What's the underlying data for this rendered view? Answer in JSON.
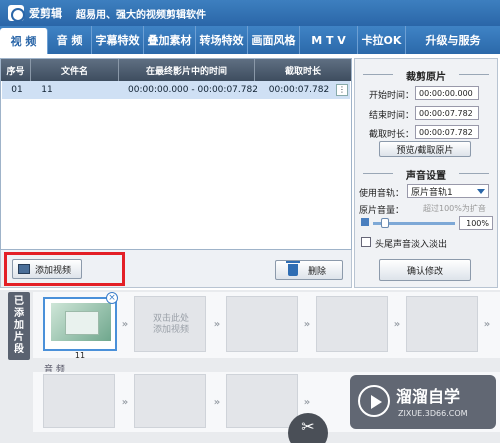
{
  "app": {
    "name": "爱剪辑",
    "slogan": "超易用、强大的视频剪辑软件"
  },
  "menu": {
    "tabs": [
      "视 频",
      "音 频",
      "字幕特效",
      "叠加素材",
      "转场特效",
      "画面风格",
      "M T V",
      "卡拉OK",
      "升级与服务"
    ],
    "active": "视 频"
  },
  "table": {
    "headers": [
      "序号",
      "文件名",
      "在最终影片中的时间",
      "截取时长"
    ],
    "rows": [
      {
        "index": "01",
        "filename": "11",
        "time_range": "00:00:00.000 - 00:00:07.782",
        "duration": "00:00:07.782"
      }
    ]
  },
  "toolbar": {
    "add_label": "添加视频",
    "delete_label": "删除"
  },
  "right_panel": {
    "trim_title": "裁剪原片",
    "start_label": "开始时间：",
    "start_value": "00:00:00.000",
    "end_label": "结束时间：",
    "end_value": "00:00:07.782",
    "duration_label": "截取时长：",
    "duration_value": "00:00:07.782",
    "preview_button": "预览/截取原片",
    "audio_title": "声音设置",
    "track_label": "使用音轨：",
    "track_value": "原片音轨1",
    "volume_label": "原片音量：",
    "volume_hint": "超过100%为扩音",
    "volume_value": "100%",
    "fade_label": "头尾声音淡入淡出",
    "confirm_button": "确认修改"
  },
  "timeline": {
    "side_label": [
      "已",
      "添",
      "加",
      "片",
      "段"
    ],
    "first_clip_caption": "11",
    "add_hint": "双击此处\n添加视频",
    "audio_label": "音 频"
  },
  "watermark": {
    "title": "溜溜自学",
    "subtitle": "ZIXUE.3D66.COM"
  }
}
